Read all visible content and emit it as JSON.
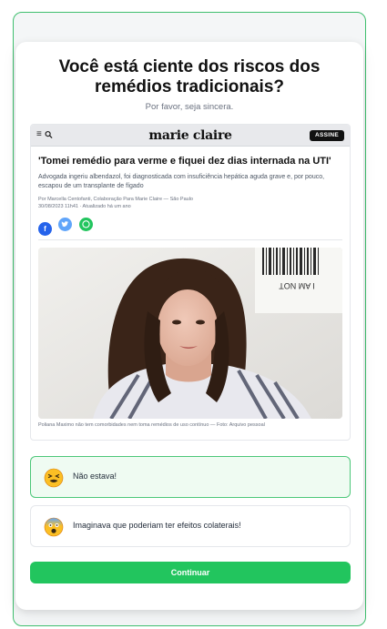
{
  "quiz": {
    "title": "Você está ciente dos riscos dos remédios tradicionais?",
    "subtitle": "Por favor, seja sincera.",
    "options": [
      {
        "label": "Não estava!",
        "icon": "tired-face-emoji-icon",
        "selected": true
      },
      {
        "label": "Imaginava que poderiam ter efeitos colaterais!",
        "icon": "scared-face-emoji-icon",
        "selected": false
      }
    ],
    "continue_label": "Continuar"
  },
  "article": {
    "brand": "marie claire",
    "subscribe_label": "ASSINE",
    "headline": "'Tomei remédio para verme e fiquei dez dias internada na UTI'",
    "lede": "Advogada ingeriu albendazol, foi diagnosticada com insuficiência hepática aguda grave e, por pouco, escapou de um transplante de fígado",
    "byline": "Por Marcella Centofanti, Colaboração Para Marie Claire — São Paulo",
    "date": "30/08/2023 11h41 · Atualizado há um ano",
    "share_icons": [
      "facebook-icon",
      "twitter-icon",
      "whatsapp-icon"
    ],
    "photo_text": "I AM NOT",
    "caption": "Poliana Maximo não tem comorbidades nem toma remédios de uso contínuo — Foto: Arquivo pessoal"
  },
  "colors": {
    "accent": "#22c55e",
    "selected_bg": "#effbf2",
    "selected_border": "#4cc779"
  }
}
